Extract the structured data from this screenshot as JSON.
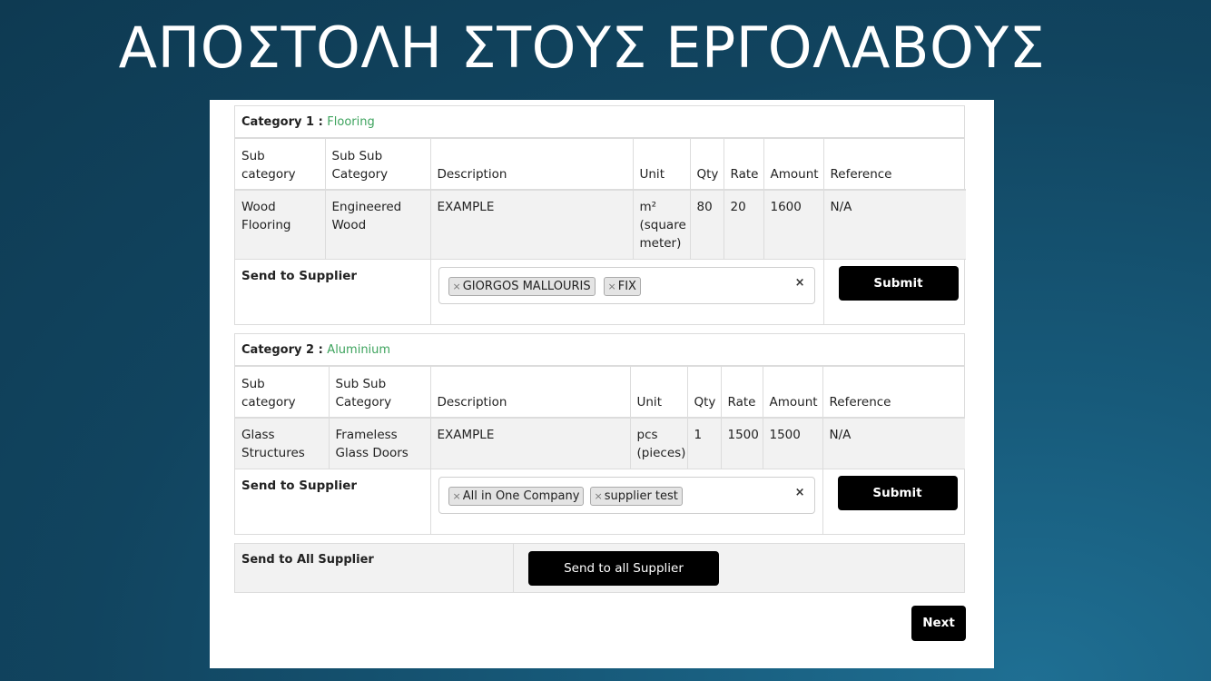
{
  "slide_title": "ΑΠΟΣΤΟΛΗ ΣΤΟΥΣ ΕΡΓΟΛΑΒΟΥΣ",
  "columns": [
    "Sub category",
    "Sub Sub Category",
    "Description",
    "Unit",
    "Qty",
    "Rate",
    "Amount",
    "Reference"
  ],
  "categories": [
    {
      "label": "Category 1 :",
      "name": "Flooring",
      "row": {
        "sub_category": "Wood Flooring",
        "sub_sub_category": "Engineered Wood",
        "description": "EXAMPLE",
        "unit": "m² (square meter)",
        "qty": "80",
        "rate": "20",
        "amount": "1600",
        "reference": "N/A"
      },
      "send_label": "Send to Supplier",
      "suppliers": [
        "GIORGOS MALLOURIS",
        "FIX"
      ],
      "submit_label": "Submit"
    },
    {
      "label": "Category 2 :",
      "name": "Aluminium",
      "row": {
        "sub_category": "Glass Structures",
        "sub_sub_category": "Frameless Glass Doors",
        "description": "EXAMPLE",
        "unit": "pcs (pieces)",
        "qty": "1",
        "rate": "1500",
        "amount": "1500",
        "reference": "N/A"
      },
      "send_label": "Send to Supplier",
      "suppliers": [
        "All in One Company",
        "supplier test"
      ],
      "submit_label": "Submit"
    }
  ],
  "tag_remove_glyph": "×",
  "clear_glyph": "×",
  "send_all": {
    "label": "Send to All Supplier",
    "button": "Send to all Supplier"
  },
  "next_label": "Next",
  "colors": {
    "category_name": "#3da35d",
    "button": "#000000"
  }
}
